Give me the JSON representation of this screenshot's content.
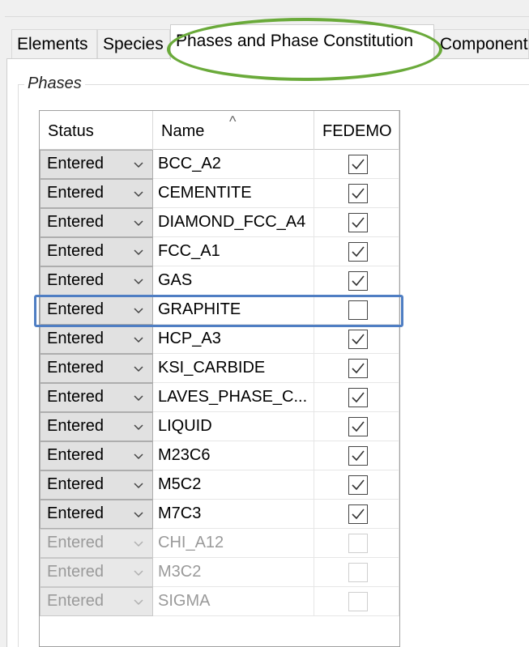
{
  "tabs": [
    {
      "label": "Elements"
    },
    {
      "label": "Species"
    },
    {
      "label": "Phases and Phase Constitution",
      "active": true
    },
    {
      "label": "Components"
    }
  ],
  "group_title": "Phases",
  "columns": {
    "status": "Status",
    "name": "Name",
    "fedemo": "FEDEMO"
  },
  "rows": [
    {
      "status": "Entered",
      "name": "BCC_A2",
      "checked": true,
      "enabled": true
    },
    {
      "status": "Entered",
      "name": "CEMENTITE",
      "checked": true,
      "enabled": true
    },
    {
      "status": "Entered",
      "name": "DIAMOND_FCC_A4",
      "checked": true,
      "enabled": true
    },
    {
      "status": "Entered",
      "name": "FCC_A1",
      "checked": true,
      "enabled": true
    },
    {
      "status": "Entered",
      "name": "GAS",
      "checked": true,
      "enabled": true
    },
    {
      "status": "Entered",
      "name": "GRAPHITE",
      "checked": false,
      "enabled": true
    },
    {
      "status": "Entered",
      "name": "HCP_A3",
      "checked": true,
      "enabled": true
    },
    {
      "status": "Entered",
      "name": "KSI_CARBIDE",
      "checked": true,
      "enabled": true
    },
    {
      "status": "Entered",
      "name": "LAVES_PHASE_C...",
      "checked": true,
      "enabled": true
    },
    {
      "status": "Entered",
      "name": "LIQUID",
      "checked": true,
      "enabled": true
    },
    {
      "status": "Entered",
      "name": "M23C6",
      "checked": true,
      "enabled": true
    },
    {
      "status": "Entered",
      "name": "M5C2",
      "checked": true,
      "enabled": true
    },
    {
      "status": "Entered",
      "name": "M7C3",
      "checked": true,
      "enabled": true
    },
    {
      "status": "Entered",
      "name": "CHI_A12",
      "checked": false,
      "enabled": false
    },
    {
      "status": "Entered",
      "name": "M3C2",
      "checked": false,
      "enabled": false
    },
    {
      "status": "Entered",
      "name": "SIGMA",
      "checked": false,
      "enabled": false
    }
  ],
  "colors": {
    "highlight_blue": "#4f7ec3",
    "annotation_green": "#6aaa3a"
  }
}
